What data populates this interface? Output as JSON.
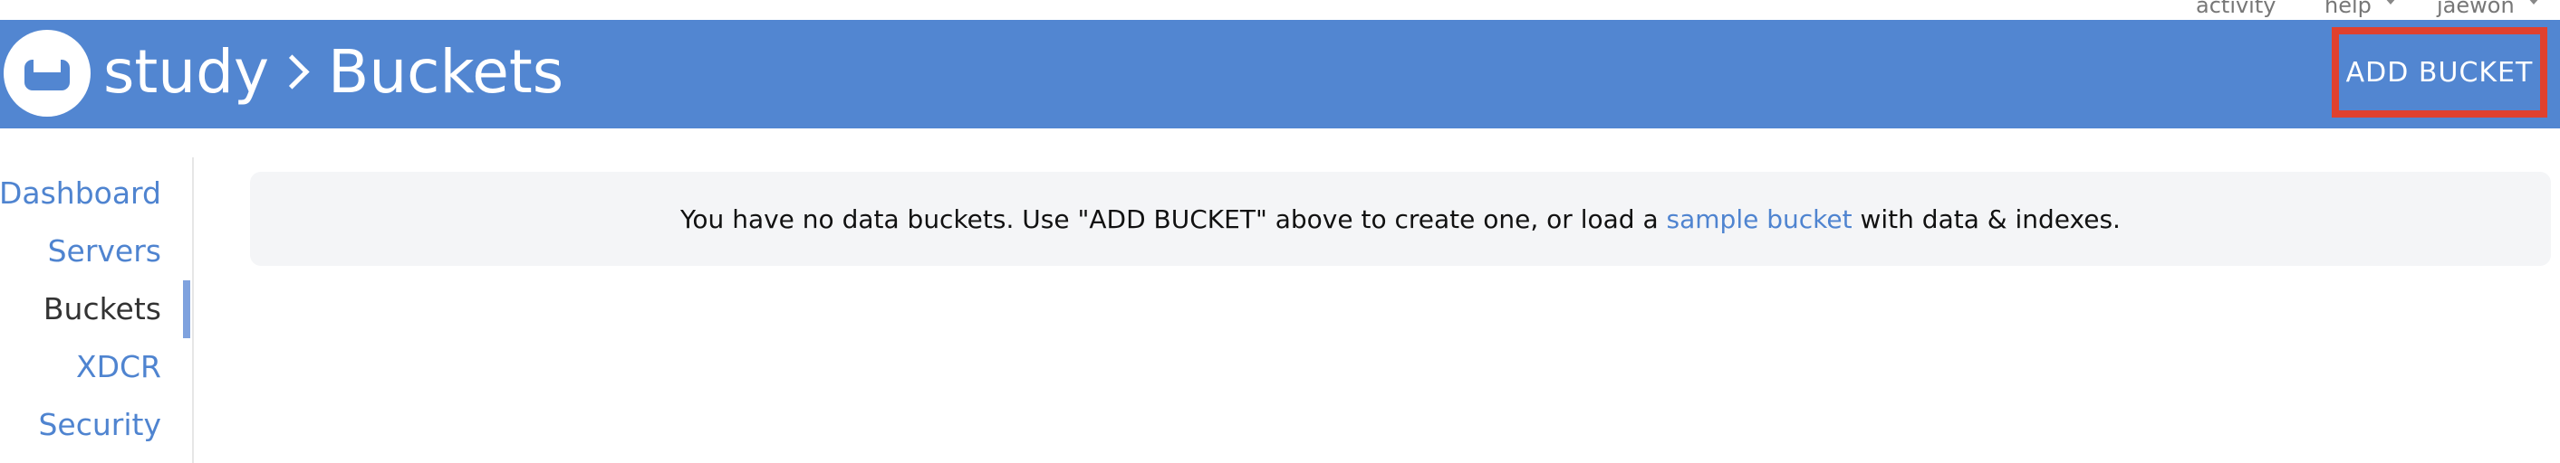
{
  "topbar": {
    "activity": "activity",
    "help": "help",
    "user": "jaewon"
  },
  "header": {
    "cluster_name": "study",
    "section": "Buckets",
    "add_bucket_label": "ADD BUCKET"
  },
  "sidebar": {
    "items": [
      {
        "label": "Dashboard",
        "active": false
      },
      {
        "label": "Servers",
        "active": false
      },
      {
        "label": "Buckets",
        "active": true
      },
      {
        "label": "XDCR",
        "active": false
      },
      {
        "label": "Security",
        "active": false
      }
    ]
  },
  "main": {
    "message_before": "You have no data buckets. Use \"ADD BUCKET\" above to create one, or load a",
    "message_link": "sample bucket",
    "message_after": "with data & indexes."
  },
  "colors": {
    "header_bg": "#5286d1",
    "link": "#4f84d0",
    "highlight": "#e0412e"
  },
  "icons": [
    "couchbase-logo-icon",
    "chevron-right-icon",
    "caret-down-icon"
  ]
}
